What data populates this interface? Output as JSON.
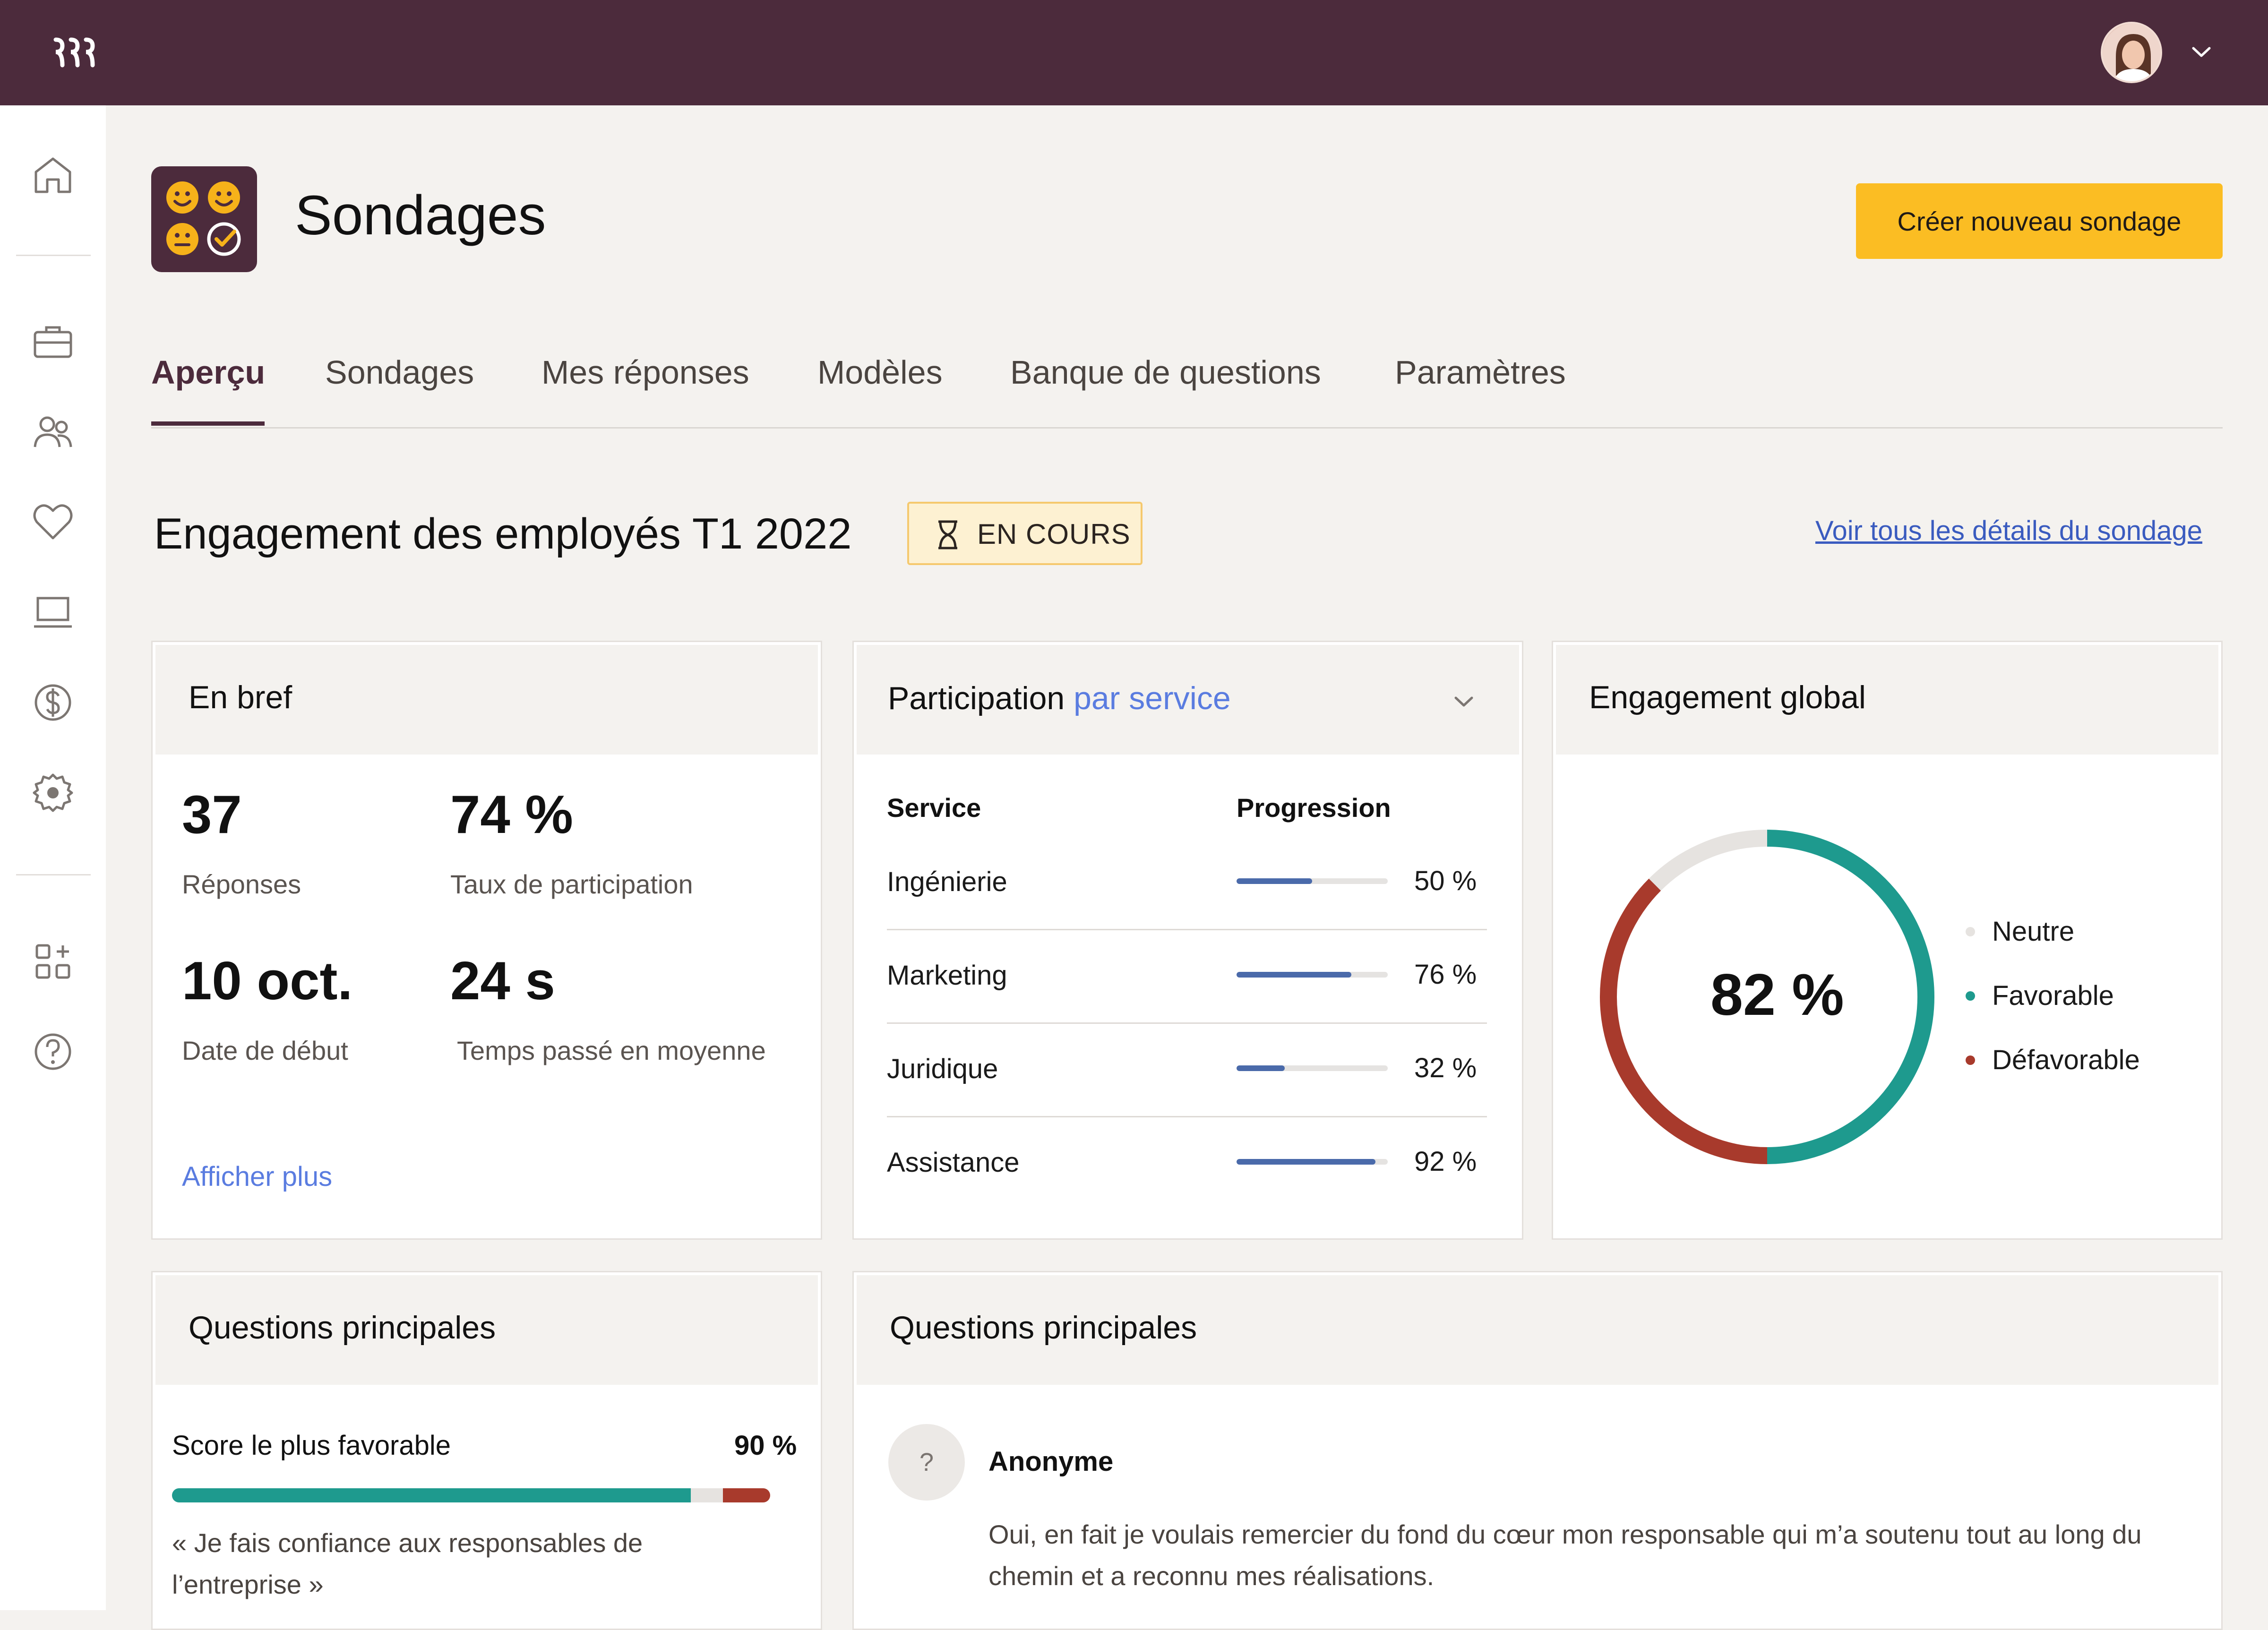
{
  "header": {
    "logo": "rippling-logo",
    "avatar_alt": "user-avatar"
  },
  "sidebar": {
    "items": [
      {
        "icon": "home-icon"
      },
      {
        "icon": "briefcase-icon"
      },
      {
        "icon": "people-icon"
      },
      {
        "icon": "heart-icon"
      },
      {
        "icon": "laptop-icon"
      },
      {
        "icon": "dollar-icon"
      },
      {
        "icon": "gear-icon"
      },
      {
        "icon": "apps-add-icon"
      },
      {
        "icon": "help-icon"
      }
    ]
  },
  "app": {
    "title": "Sondages",
    "create_button": "Créer nouveau sondage"
  },
  "tabs": [
    {
      "label": "Aperçu",
      "active": true
    },
    {
      "label": "Sondages"
    },
    {
      "label": "Mes réponses"
    },
    {
      "label": "Modèles"
    },
    {
      "label": "Banque de questions"
    },
    {
      "label": "Paramètres"
    }
  ],
  "survey": {
    "title": "Engagement des employés T1 2022",
    "status": "EN COURS",
    "details_link": "Voir tous les détails du sondage"
  },
  "summary": {
    "title": "En bref",
    "responses_value": "37",
    "responses_label": "Réponses",
    "participation_value": "74 %",
    "participation_label": "Taux de participation",
    "start_value": "10 oct.",
    "start_label": "Date de début",
    "time_value": "24 s",
    "time_label": "Temps passé en moyenne",
    "more_link": "Afficher plus"
  },
  "participation": {
    "title": "Participation",
    "title_accent": "par service",
    "col_service": "Service",
    "col_progress": "Progression",
    "rows": [
      {
        "name": "Ingénierie",
        "pct_label": "50 %",
        "value": 0.5
      },
      {
        "name": "Marketing",
        "pct_label": "76 %",
        "value": 0.76
      },
      {
        "name": "Juridique",
        "pct_label": "32 %",
        "value": 0.32
      },
      {
        "name": "Assistance",
        "pct_label": "92 %",
        "value": 0.92
      }
    ]
  },
  "engagement": {
    "title": "Engagement global",
    "center_label": "82 %",
    "legend": [
      {
        "label": "Neutre",
        "color": "#e6e3e0"
      },
      {
        "label": "Favorable",
        "color": "#1e9a8e"
      },
      {
        "label": "Défavorable",
        "color": "#a83a2c"
      }
    ],
    "segments": {
      "favorable": 0.5,
      "defavorable": 0.375,
      "neutre": 0.125
    }
  },
  "top_questions_left": {
    "title": "Questions principales",
    "score_label": "Score le plus favorable",
    "score_pct": "90 %",
    "bar": {
      "favorable": 0.867,
      "neutre": 0.054,
      "defavorable": 0.079
    },
    "quote": "« Je fais confiance aux responsables de l’entreprise »"
  },
  "top_questions_right": {
    "title": "Questions principales",
    "avatar_text": "?",
    "author": "Anonyme",
    "comment": "Oui, en fait je voulais remercier du fond du cœur mon responsable qui m’a soutenu tout au long du chemin et a reconnu mes réalisations."
  }
}
